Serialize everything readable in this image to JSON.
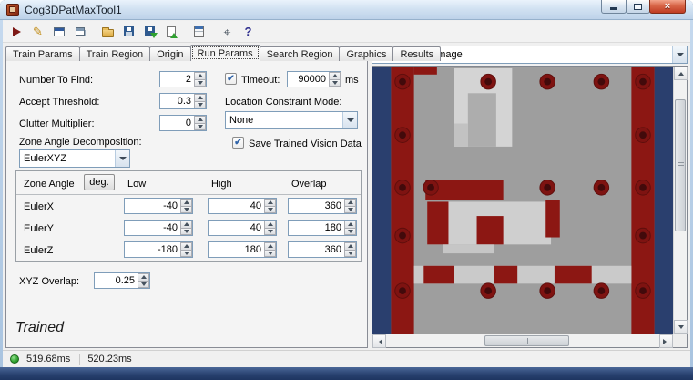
{
  "window": {
    "title": "Cog3DPatMaxTool1"
  },
  "toolbar": {
    "items": [
      {
        "name": "run-icon",
        "glyph": ""
      },
      {
        "name": "electric-pencil-icon",
        "glyph": "✎"
      },
      {
        "name": "tool-window-icon",
        "glyph": ""
      },
      {
        "name": "float-window-icon",
        "glyph": ""
      },
      {
        "name": "open-folder-icon",
        "glyph": ""
      },
      {
        "name": "save-icon",
        "glyph": ""
      },
      {
        "name": "import-icon",
        "glyph": ""
      },
      {
        "name": "export-icon",
        "glyph": ""
      },
      {
        "name": "calculator-icon",
        "glyph": ""
      },
      {
        "name": "coordinate-tool-icon",
        "glyph": "⌖"
      },
      {
        "name": "help-icon",
        "glyph": "?"
      }
    ]
  },
  "tabs": {
    "items": [
      {
        "label": "Train Params",
        "active": false
      },
      {
        "label": "Train Region",
        "active": false
      },
      {
        "label": "Origin",
        "active": false
      },
      {
        "label": "Run Params",
        "active": true
      },
      {
        "label": "Search Region",
        "active": false
      },
      {
        "label": "Graphics",
        "active": false
      },
      {
        "label": "Results",
        "active": false
      }
    ]
  },
  "run_params": {
    "number_to_find": {
      "label": "Number To Find:",
      "value": "2"
    },
    "accept_threshold": {
      "label": "Accept Threshold:",
      "value": "0.3"
    },
    "clutter_multiplier": {
      "label": "Clutter Multiplier:",
      "value": "0"
    },
    "timeout": {
      "label": "Timeout:",
      "value": "90000",
      "unit": "ms",
      "checked": true
    },
    "location_constraint": {
      "label": "Location Constraint Mode:",
      "value": "None"
    },
    "save_trained": {
      "label": "Save Trained Vision Data",
      "checked": true
    },
    "zone_angle_decomposition": {
      "label": "Zone Angle Decomposition:",
      "value": "EulerXYZ"
    },
    "zone_table": {
      "headers": {
        "zone_angle": "Zone Angle",
        "deg_button": "deg.",
        "low": "Low",
        "high": "High",
        "overlap": "Overlap"
      },
      "rows": [
        {
          "name": "EulerX",
          "low": "-40",
          "high": "40",
          "overlap": "360"
        },
        {
          "name": "EulerY",
          "low": "-40",
          "high": "40",
          "overlap": "180"
        },
        {
          "name": "EulerZ",
          "low": "-180",
          "high": "180",
          "overlap": "360"
        }
      ]
    },
    "xyz_overlap": {
      "label": "XYZ Overlap:",
      "value": "0.25"
    },
    "status": "Trained"
  },
  "image_panel": {
    "source": "Current.InputImage"
  },
  "status_bar": {
    "time1": "519.68ms",
    "time2": "520.23ms"
  },
  "icons": {
    "check": "✔"
  },
  "colors": {
    "status_green": "#2FA12F",
    "image_navy": "#2A3F6E",
    "image_red": "#8C1713",
    "image_gray": "#9E9E9E",
    "image_light": "#CFCFCF"
  }
}
